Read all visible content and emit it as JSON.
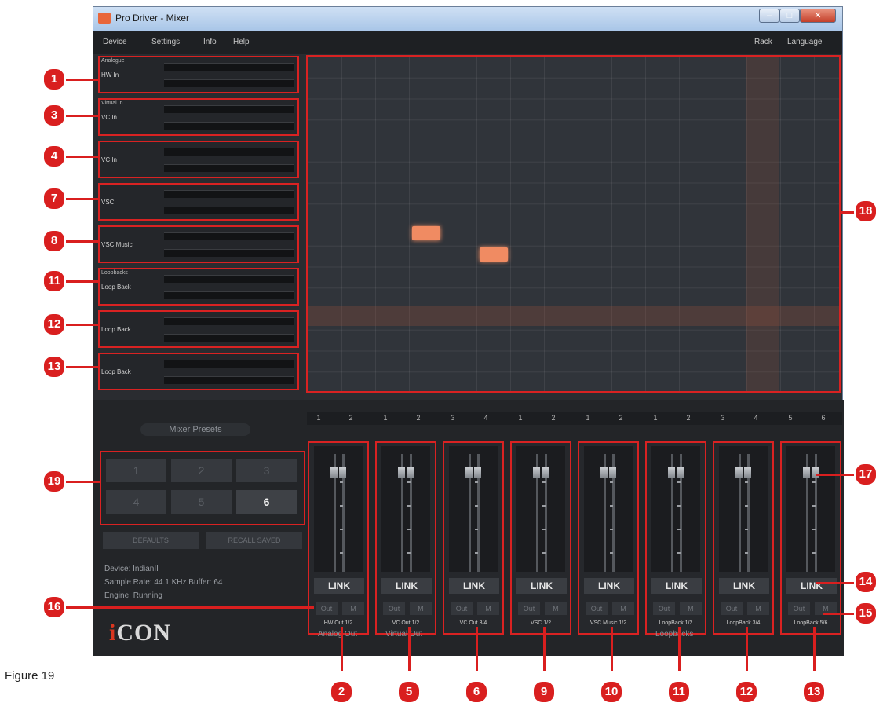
{
  "window": {
    "title": "Pro Driver - Mixer"
  },
  "menu": {
    "left": [
      "Device",
      "Settings",
      "Info",
      "Help"
    ],
    "right": [
      "Rack",
      "Language"
    ]
  },
  "inputs": [
    {
      "top": "Analogue",
      "name": "HW In"
    },
    {
      "top": "Virtual In",
      "name": "VC In"
    },
    {
      "top": "",
      "name": "VC In"
    },
    {
      "top": "",
      "name": "VSC"
    },
    {
      "top": "",
      "name": "VSC Music"
    },
    {
      "top": "Loopbacks",
      "name": "Loop Back"
    },
    {
      "top": "",
      "name": "Loop Back"
    },
    {
      "top": "",
      "name": "Loop Back"
    }
  ],
  "channel_numbers": [
    "1",
    "2",
    "1",
    "2",
    "3",
    "4",
    "1",
    "2",
    "1",
    "2",
    "1",
    "2",
    "3",
    "4",
    "5",
    "6"
  ],
  "presets": {
    "title": "Mixer Presets",
    "buttons": [
      "1",
      "2",
      "3",
      "4",
      "5",
      "6"
    ],
    "active": "6",
    "defaults_label": "DEFAULTS",
    "recall_label": "RECALL SAVED"
  },
  "status": {
    "device": "Device: IndianII",
    "sample_rate": "Sample Rate: 44.1 KHz  Buffer: 64",
    "engine": "Engine: Running"
  },
  "logo": {
    "i": "i",
    "rest": "CON"
  },
  "strips": [
    {
      "link": "LINK",
      "solo": "Out",
      "mute": "M",
      "label": "HW Out 1/2"
    },
    {
      "link": "LINK",
      "solo": "Out",
      "mute": "M",
      "label": "VC Out 1/2"
    },
    {
      "link": "LINK",
      "solo": "Out",
      "mute": "M",
      "label": "VC Out 3/4"
    },
    {
      "link": "LINK",
      "solo": "Out",
      "mute": "M",
      "label": "VSC 1/2"
    },
    {
      "link": "LINK",
      "solo": "Out",
      "mute": "M",
      "label": "VSC Music 1/2"
    },
    {
      "link": "LINK",
      "solo": "Out",
      "mute": "M",
      "label": "LoopBack 1/2"
    },
    {
      "link": "LINK",
      "solo": "Out",
      "mute": "M",
      "label": "LoopBack 3/4"
    },
    {
      "link": "LINK",
      "solo": "Out",
      "mute": "M",
      "label": "LoopBack 5/6"
    }
  ],
  "group_labels": {
    "analog": "Analog Out",
    "virtual": "Virtual Out",
    "loop": "Loopbacks"
  },
  "callouts": {
    "left": [
      "1",
      "3",
      "4",
      "7",
      "8",
      "11",
      "12",
      "13",
      "19",
      "16"
    ],
    "right": [
      "18",
      "17",
      "14",
      "15"
    ],
    "bottom": [
      "2",
      "5",
      "6",
      "9",
      "10",
      "11",
      "12",
      "13"
    ]
  },
  "caption": "Figure 19"
}
